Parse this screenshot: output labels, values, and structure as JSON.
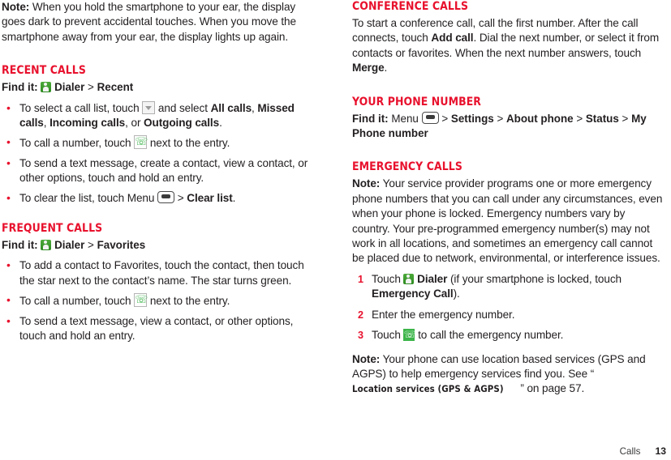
{
  "document": {
    "footer": {
      "section_label": "Calls",
      "page_number": "13"
    }
  },
  "colors": {
    "heading_red": "#e8112d",
    "bullet_red": "#e8112d",
    "icon_green": "#3cb54a",
    "body_text": "#231f20"
  },
  "left_column": {
    "intro_note": {
      "label": "Note:",
      "text": " When you hold the smartphone to your ear, the display goes dark to prevent accidental touches. When you move the smartphone away from your ear, the display lights up again."
    },
    "recent_calls": {
      "heading": "Recent calls",
      "find_it": {
        "label": "Find it:",
        "icon": "dialer-icon",
        "app": "Dialer",
        "separator": ">",
        "target": "Recent"
      },
      "bullets": [
        {
          "part1": "To select a call list, touch ",
          "icon": "dropdown-icon",
          "part2": " and select ",
          "b1": "All calls",
          "part3": ", ",
          "b2": "Missed calls",
          "part4": ", ",
          "b3": "Incoming calls",
          "part5": ", or ",
          "b4": "Outgoing calls",
          "part6": "."
        },
        {
          "part1": "To call a number, touch ",
          "icon": "call-icon",
          "part2": " next to the entry."
        },
        {
          "part1": "To send a text message, create a contact, view a contact, or other options, touch and hold an entry."
        },
        {
          "part1": "To clear the list, touch Menu ",
          "icon": "menu-icon",
          "part2": " > ",
          "b1": "Clear list",
          "part3": "."
        }
      ]
    },
    "frequent_calls": {
      "heading": "Frequent calls",
      "find_it": {
        "label": "Find it:",
        "icon": "dialer-icon",
        "app": "Dialer",
        "separator": ">",
        "target": "Favorites"
      },
      "bullets": [
        {
          "part1": "To add a contact to Favorites, touch the contact, then touch the star next to the contact’s name. The star turns green."
        },
        {
          "part1": "To call a number, touch ",
          "icon": "call-icon",
          "part2": " next to the entry."
        },
        {
          "part1": "To send a text message, view a contact, or other options, touch and hold an entry."
        }
      ]
    }
  },
  "right_column": {
    "conference_calls": {
      "heading": "Conference calls",
      "body": {
        "part1": "To start a conference call, call the first number. After the call connects, touch ",
        "b1": "Add call",
        "part2": ". Dial the next number, or select it from contacts or favorites. When the next number answers, touch ",
        "b2": "Merge",
        "part3": "."
      }
    },
    "your_phone_number": {
      "heading": "Your phone number",
      "find_it": {
        "label": "Find it:",
        "menu_word": "Menu",
        "icon": "menu-icon",
        "sep1": ">",
        "b1": "Settings",
        "sep2": ">",
        "b2": "About phone",
        "sep3": ">",
        "b3": "Status",
        "sep4": ">",
        "b4": "My Phone number"
      }
    },
    "emergency_calls": {
      "heading": "Emergency calls",
      "note": {
        "label": "Note:",
        "text": " Your service provider programs one or more emergency phone numbers that you can call under any circumstances, even when your phone is locked. Emergency numbers vary by country. Your pre-programmed emergency number(s) may not work in all locations, and sometimes an emergency call cannot be placed due to network, environmental, or interference issues."
      },
      "steps": [
        {
          "part1": "Touch ",
          "icon": "dialer-icon",
          "b1": "Dialer",
          "part2": " (if your smartphone is locked, touch ",
          "b2": "Emergency Call",
          "part3": ")."
        },
        {
          "part1": "Enter the emergency number."
        },
        {
          "part1": "Touch ",
          "icon": "call-icon-solid",
          "part2": " to call the emergency number."
        }
      ],
      "footnote": {
        "label": "Note:",
        "part1": " Your phone can use location based services (GPS and AGPS) to help emergency services find you. See “",
        "ref": "Location services (GPS & AGPS)",
        "part2": "” on page 57."
      }
    }
  }
}
